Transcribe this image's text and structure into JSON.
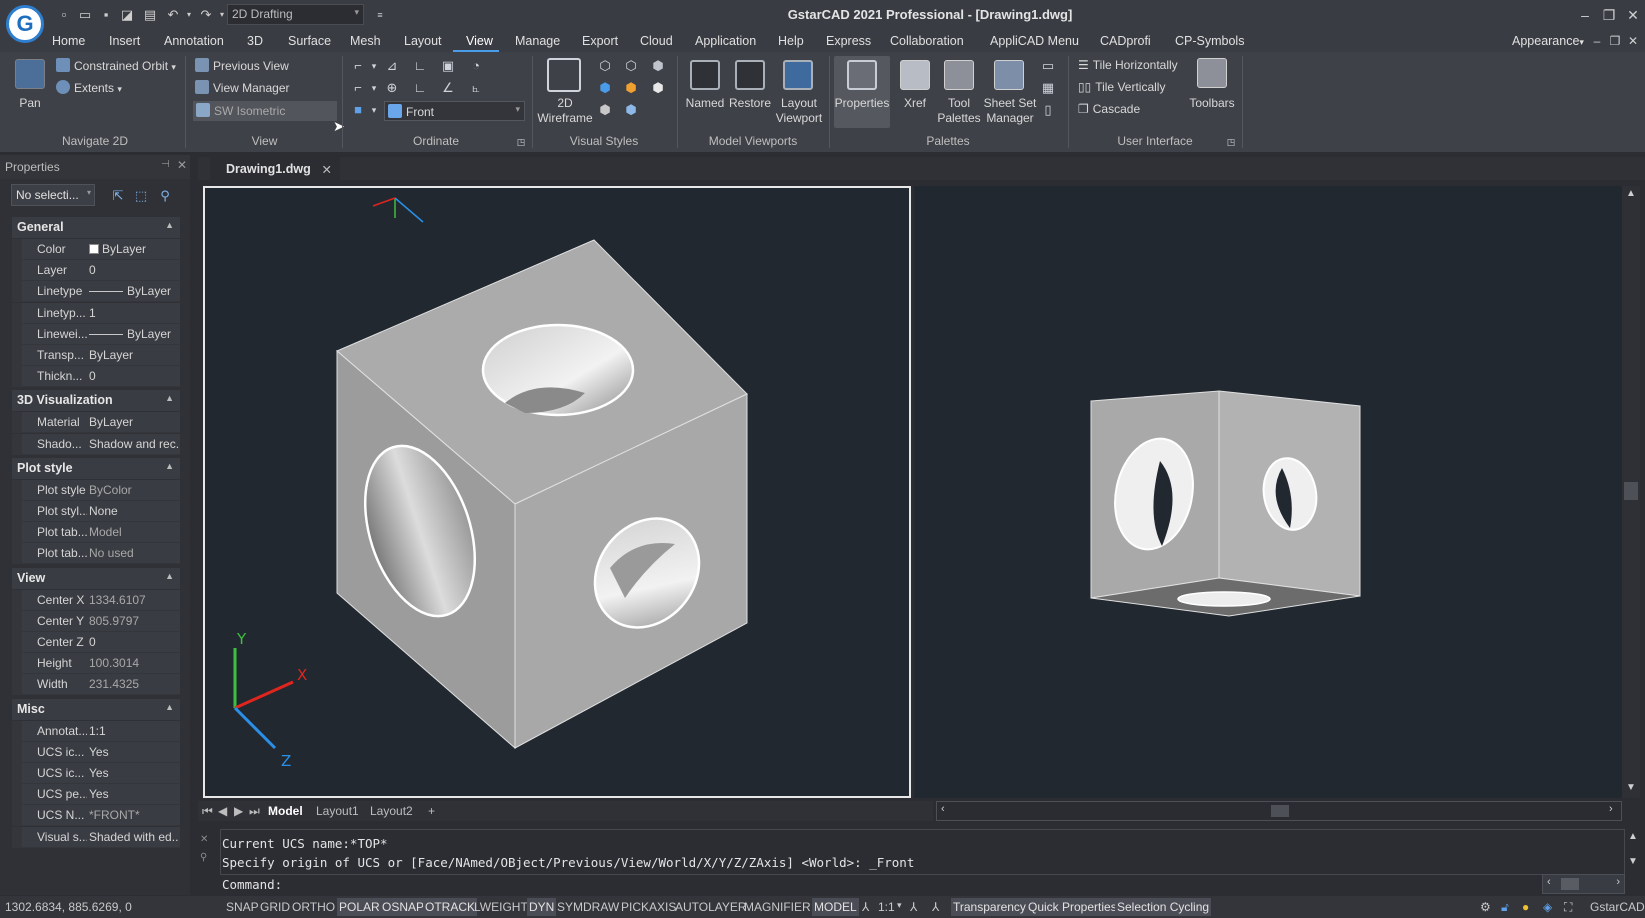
{
  "app": {
    "title": "GstarCAD 2021 Professional - [Drawing1.dwg]",
    "logo_letter": "G",
    "workspace": "2D Drafting"
  },
  "menu": [
    "Home",
    "Insert",
    "Annotation",
    "3D",
    "Surface",
    "Mesh",
    "Layout",
    "View",
    "Manage",
    "Export",
    "Cloud",
    "Application",
    "Help",
    "Express",
    "Collaboration",
    "AppliCAD Menu",
    "CADprofi",
    "CP-Symbols"
  ],
  "menu_active": "View",
  "appearance": "Appearance",
  "ribbon": {
    "navigate": {
      "pan": "Pan",
      "orbit": "Constrained Orbit",
      "extents": "Extents",
      "label": "Navigate 2D"
    },
    "view": {
      "previous": "Previous View",
      "manager": "View Manager",
      "preset": "SW Isometric",
      "label": "View"
    },
    "ordinate": {
      "ucs": "Front",
      "label": "Ordinate"
    },
    "visual": {
      "wireframe_1": "2D",
      "wireframe_2": "Wireframe",
      "label": "Visual Styles"
    },
    "viewports": {
      "named": "Named",
      "restore": "Restore",
      "layout_1": "Layout",
      "layout_2": "Viewport",
      "label": "Model Viewports"
    },
    "palettes": {
      "properties": "Properties",
      "xref": "Xref",
      "tool_1": "Tool",
      "tool_2": "Palettes",
      "sheet_1": "Sheet Set",
      "sheet_2": "Manager",
      "label": "Palettes"
    },
    "ui": {
      "tile_h": "Tile Horizontally",
      "tile_v": "Tile Vertically",
      "cascade": "Cascade",
      "toolbars": "Toolbars",
      "label": "User Interface"
    }
  },
  "properties": {
    "title": "Properties",
    "selection": "No selecti...",
    "sections": [
      {
        "name": "General",
        "rows": [
          {
            "k": "Color",
            "v": "ByLayer"
          },
          {
            "k": "Layer",
            "v": "0"
          },
          {
            "k": "Linetype",
            "v": "ByLayer"
          },
          {
            "k": "Linetyp...",
            "v": "1"
          },
          {
            "k": "Linewei...",
            "v": "ByLayer"
          },
          {
            "k": "Transp...",
            "v": "ByLayer"
          },
          {
            "k": "Thickn...",
            "v": "0"
          }
        ]
      },
      {
        "name": "3D Visualization",
        "rows": [
          {
            "k": "Material",
            "v": "ByLayer"
          },
          {
            "k": "Shado...",
            "v": "Shadow and rec..."
          }
        ]
      },
      {
        "name": "Plot style",
        "rows": [
          {
            "k": "Plot style",
            "v": "ByColor"
          },
          {
            "k": "Plot styl...",
            "v": "None"
          },
          {
            "k": "Plot tab...",
            "v": "Model"
          },
          {
            "k": "Plot tab...",
            "v": "No used"
          }
        ]
      },
      {
        "name": "View",
        "rows": [
          {
            "k": "Center X",
            "v": "1334.6107"
          },
          {
            "k": "Center Y",
            "v": "805.9797"
          },
          {
            "k": "Center Z",
            "v": "0"
          },
          {
            "k": "Height",
            "v": "100.3014"
          },
          {
            "k": "Width",
            "v": "231.4325"
          }
        ]
      },
      {
        "name": "Misc",
        "rows": [
          {
            "k": "Annotat...",
            "v": "1:1"
          },
          {
            "k": "UCS ic...",
            "v": "Yes"
          },
          {
            "k": "UCS ic...",
            "v": "Yes"
          },
          {
            "k": "UCS pe...",
            "v": "Yes"
          },
          {
            "k": "UCS N...",
            "v": "*FRONT*"
          },
          {
            "k": "Visual s...",
            "v": "Shaded with ed..."
          }
        ]
      }
    ]
  },
  "document_tab": "Drawing1.dwg",
  "axes": {
    "x": "X",
    "y": "Y",
    "z": "Z"
  },
  "layout_tabs": [
    "Model",
    "Layout1",
    "Layout2",
    "+"
  ],
  "command": {
    "line1": "Current UCS name:*TOP*",
    "line2": "Specify origin of UCS or [Face/NAmed/OBject/Previous/View/World/X/Y/Z/ZAxis] <World>: _Front",
    "prompt": "Command:"
  },
  "status": {
    "coords": "1302.6834, 885.6269, 0",
    "toggles": [
      "SNAP",
      "GRID",
      "ORTHO",
      "POLAR",
      "OSNAP",
      "OTRACK",
      "LWEIGHT",
      "DYN",
      "SYMDRAW",
      "PICKAXIS",
      "AUTOLAYER",
      "MAGNIFIER",
      "MODEL"
    ],
    "scale": "1:1",
    "extras": [
      "Transparency",
      "Quick Properties",
      "Selection Cycling"
    ],
    "brand": "GstarCAD"
  },
  "colors": {
    "accent": "#4a9be8",
    "viewport_bg": "#212830",
    "axis_x": "#e0251e",
    "axis_y": "#3fbf3f",
    "axis_z": "#2a8fe6"
  }
}
